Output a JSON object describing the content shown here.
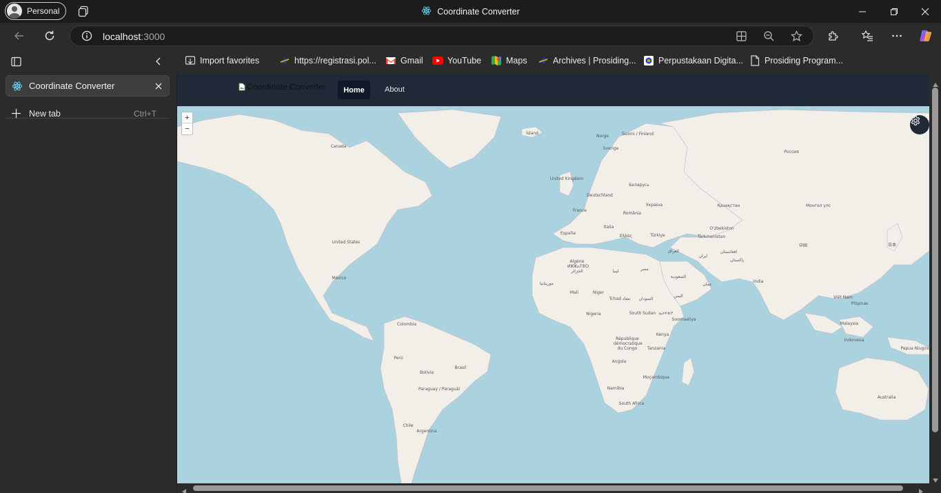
{
  "browser": {
    "profile_label": "Personal",
    "window_title": "Coordinate Converter",
    "url_host": "localhost",
    "url_port": ":3000"
  },
  "sidebar": {
    "active_tab": "Coordinate Converter",
    "new_tab_label": "New tab",
    "new_tab_shortcut": "Ctrl+T"
  },
  "bookmarks": [
    {
      "label": "Import favorites",
      "icon": "import-icon"
    },
    {
      "label": "https://registrasi.pol...",
      "icon": "site-icon"
    },
    {
      "label": "Gmail",
      "icon": "gmail-icon"
    },
    {
      "label": "YouTube",
      "icon": "youtube-icon"
    },
    {
      "label": "Maps",
      "icon": "maps-icon"
    },
    {
      "label": "Archives | Prosiding...",
      "icon": "site-icon"
    },
    {
      "label": "Perpustakaan Digita...",
      "icon": "library-icon"
    },
    {
      "label": "Prosiding Program...",
      "icon": "page-icon"
    }
  ],
  "app": {
    "logo_alt": "Coordinate Converter",
    "nav_home": "Home",
    "nav_about": "About"
  },
  "map": {
    "zoom_in": "+",
    "zoom_out": "−",
    "labels": {
      "canada": "Canada",
      "united_states": "United States",
      "mexico": "México",
      "colombia": "Colombia",
      "peru": "Perú",
      "bolivia": "Bolivia",
      "brasil": "Brasil",
      "paraguay": "Paraguay / Paraguái",
      "argentina": "Argentina",
      "chile": "Chile",
      "island": "Ísland",
      "norge": "Norge",
      "sverige": "Sverige",
      "suomi": "Suomi / Finland",
      "uk": "United Kingdom",
      "deutschland": "Deutschland",
      "france": "France",
      "espana": "España",
      "italia": "Italia",
      "romania": "România",
      "ukraina": "Україна",
      "belarus": "Беларусь",
      "ellas": "Ελλάς",
      "turkiye": "Türkiye",
      "rossiya": "Россия",
      "kazakhstan": "Қазақстан",
      "mongol": "Монгол улс",
      "uzbekistan": "Oʻzbekiston",
      "turkmenistan": "Türkmenistan",
      "iraq": "العراق",
      "iran": "ایران",
      "afghanistan": "افغانستان",
      "pakistan": "پاکستان",
      "china": "中国",
      "japan": "日本",
      "india": "India",
      "saudi": "السعودية",
      "algeria": "Algérie ⵍⵣⵣⴰⵢⴻⵔ الجزائر",
      "libya": "ليبيا",
      "egypt": "مصر",
      "mauritania": "موريتانيا",
      "mali": "Mali",
      "niger": "Niger",
      "chad": "Tchad تشاد",
      "sudan": "السودان",
      "nigeria": "Nigeria",
      "south_sudan": "South Sudan",
      "ethiopia": "ኢትዮጵያ",
      "somalia": "Soomaaliya",
      "kenya": "Kenya",
      "drc": "République démocratique du Congo",
      "tanzania": "Tanzania",
      "angola": "Angola",
      "namibia": "Namibia",
      "mozambique": "Moçambique",
      "south_africa": "South Africa",
      "vietnam": "Việt Nam",
      "philippines": "Pilipinas",
      "malaysia": "Malaysia",
      "indonesia": "Indonesia",
      "png": "Papua Niugini",
      "australia": "Australia",
      "yemen": "اليمن",
      "oman": "عمان"
    }
  },
  "colors": {
    "ocean": "#aad3df",
    "land": "#f2efe9",
    "navbar": "#1f2937",
    "active_nav": "#111827"
  }
}
